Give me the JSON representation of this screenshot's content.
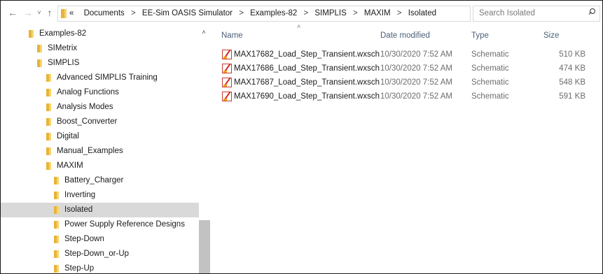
{
  "nav": {
    "back_icon": "←",
    "forward_icon": "→",
    "recent_icon": "˅",
    "up_icon": "↑",
    "dropdown_icon": "˅",
    "refresh_icon": "↻"
  },
  "address": {
    "overflow": "«",
    "crumbs": [
      "Documents",
      "EE-Sim OASIS Simulator",
      "Examples-82",
      "SIMPLIS",
      "MAXIM",
      "Isolated"
    ],
    "separator": ">"
  },
  "search": {
    "placeholder": "Search Isolated"
  },
  "tree": {
    "collapse_icon": "˄",
    "items": [
      {
        "label": "Examples-82",
        "level": 0,
        "selected": false
      },
      {
        "label": "SIMetrix",
        "level": 1,
        "selected": false
      },
      {
        "label": "SIMPLIS",
        "level": 1,
        "selected": false
      },
      {
        "label": "Advanced SIMPLIS Training",
        "level": 2,
        "selected": false
      },
      {
        "label": "Analog Functions",
        "level": 2,
        "selected": false
      },
      {
        "label": "Analysis Modes",
        "level": 2,
        "selected": false
      },
      {
        "label": "Boost_Converter",
        "level": 2,
        "selected": false
      },
      {
        "label": "Digital",
        "level": 2,
        "selected": false
      },
      {
        "label": "Manual_Examples",
        "level": 2,
        "selected": false
      },
      {
        "label": "MAXIM",
        "level": 2,
        "selected": false
      },
      {
        "label": "Battery_Charger",
        "level": 3,
        "selected": false
      },
      {
        "label": "Inverting",
        "level": 3,
        "selected": false
      },
      {
        "label": "Isolated",
        "level": 3,
        "selected": true
      },
      {
        "label": "Power Supply Reference Designs",
        "level": 3,
        "selected": false
      },
      {
        "label": "Step-Down",
        "level": 3,
        "selected": false
      },
      {
        "label": "Step-Down_or-Up",
        "level": 3,
        "selected": false
      },
      {
        "label": "Step-Up",
        "level": 3,
        "selected": false
      }
    ]
  },
  "list": {
    "sort_icon": "˄",
    "columns": {
      "name": "Name",
      "date": "Date modified",
      "type": "Type",
      "size": "Size"
    },
    "files": [
      {
        "name": "MAX17682_Load_Step_Transient.wxsch",
        "date": "10/30/2020 7:52 AM",
        "type": "Schematic",
        "size": "510 KB"
      },
      {
        "name": "MAX17686_Load_Step_Transient.wxsch",
        "date": "10/30/2020 7:52 AM",
        "type": "Schematic",
        "size": "474 KB"
      },
      {
        "name": "MAX17687_Load_Step_Transient.wxsch",
        "date": "10/30/2020 7:52 AM",
        "type": "Schematic",
        "size": "548 KB"
      },
      {
        "name": "MAX17690_Load_Step_Transient.wxsch",
        "date": "10/30/2020 7:52 AM",
        "type": "Schematic",
        "size": "591 KB"
      }
    ]
  },
  "colors": {
    "selection": "#d9d9d9",
    "folder": "#e8b33b",
    "header_text": "#4c607a"
  }
}
